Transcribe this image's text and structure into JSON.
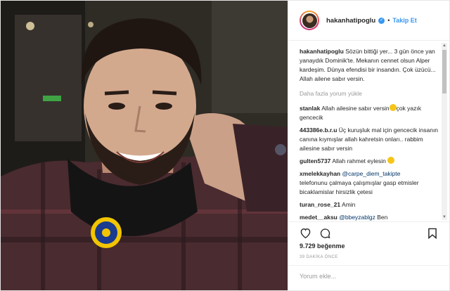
{
  "post": {
    "username": "hakanhatipoglu",
    "verified": true,
    "follow_label": "Takip Et",
    "separator": "•"
  },
  "caption": {
    "username": "hakanhatipoglu",
    "text": "Sözün bittiği yer... 3 gün önce yan yanaydık Dominik'te. Mekanın cennet olsun Alper kardeşim. Dünya efendisi bir insandın. Çok üzücü... Allah ailene sabır versin."
  },
  "load_more": "Daha fazla yorum yükle",
  "comments": [
    {
      "user": "stanlak",
      "pre": "Allah ailesine sabır versin",
      "mention": "",
      "post": "çok yazık gencecik",
      "emoji": true
    },
    {
      "user": "443386e.b.r.u",
      "pre": "Üç kuruşluk mal için gencecik insanın canına kıymışlar allah kahretsin onları.. rabbim ailesine sabır versin",
      "mention": "",
      "post": "",
      "emoji": false
    },
    {
      "user": "gulten5737",
      "pre": "Allah rahmet eylesin",
      "mention": "",
      "post": "",
      "emoji": true
    },
    {
      "user": "xmelekkayhan",
      "pre": "",
      "mention": "@carpe_diem_takipte",
      "post": "telefonunu çalmaya çalışmışlar gasp etmisler bicaklamislar hirsizlik çetesi",
      "emoji": false
    },
    {
      "user": "turan_rose_21",
      "pre": "Amin",
      "mention": "",
      "post": "",
      "emoji": false
    },
    {
      "user": "medet__aksu",
      "pre": "",
      "mention": "@bbeyzablgz",
      "post": "Ben",
      "emoji": false
    }
  ],
  "stats": {
    "likes": "9.729 beğenme",
    "time": "39 DAKİKA ÖNCE"
  },
  "comment_input": {
    "placeholder": "Yorum ekle..."
  },
  "icons": {
    "like": "heart-icon",
    "comment": "comment-icon",
    "save": "bookmark-icon",
    "verified": "verified-badge-icon"
  },
  "colors": {
    "link": "#3897f0",
    "mention": "#003569",
    "muted": "#999999"
  }
}
